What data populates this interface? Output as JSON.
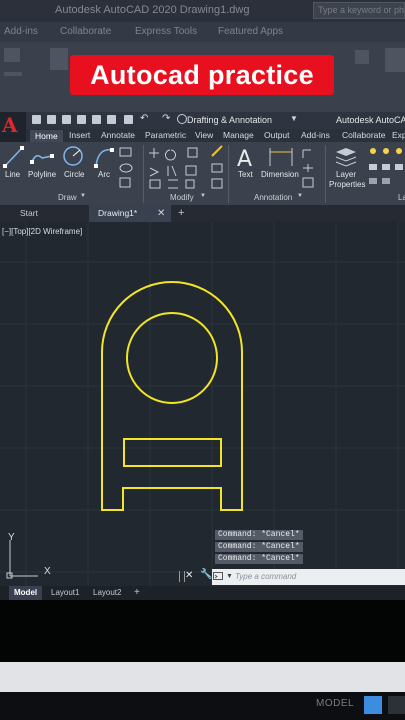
{
  "background": {
    "window_title": "Autodesk AutoCAD 2020   Drawing1.dwg",
    "search_placeholder": "Type a keyword or phr",
    "tabs": [
      "Add-ins",
      "Collaborate",
      "Express Tools",
      "Featured Apps"
    ]
  },
  "banner": {
    "text": "Autocad practice",
    "color": "#e8101e"
  },
  "quick_access": {
    "workspace": "Drafting & Annotation",
    "title": "Autodesk AutoCAD"
  },
  "ribbon_tabs": [
    "Home",
    "Insert",
    "Annotate",
    "Parametric",
    "View",
    "Manage",
    "Output",
    "Add-ins",
    "Collaborate",
    "Expr"
  ],
  "ribbon": {
    "draw": {
      "title": "Draw",
      "tools": [
        "Line",
        "Polyline",
        "Circle",
        "Arc"
      ]
    },
    "modify": {
      "title": "Modify"
    },
    "annotation": {
      "title": "Annotation",
      "tools": [
        "Text",
        "Dimension"
      ]
    },
    "layers": {
      "title": "La",
      "tool_line1": "Layer",
      "tool_line2": "Properties"
    }
  },
  "doc_tabs": {
    "start": "Start",
    "drawing": "Drawing1*"
  },
  "viewport": {
    "label": "[−][Top][2D Wireframe]"
  },
  "drawing": {
    "stroke_color": "#f2e526"
  },
  "ucs": {
    "x": "X",
    "y": "Y"
  },
  "command": {
    "history": [
      "Command: *Cancel*",
      "Command: *Cancel*",
      "Command: *Cancel*"
    ],
    "placeholder": "Type a command"
  },
  "layout_tabs": [
    "Model",
    "Layout1",
    "Layout2",
    "+"
  ],
  "status": {
    "model": "MODEL"
  }
}
